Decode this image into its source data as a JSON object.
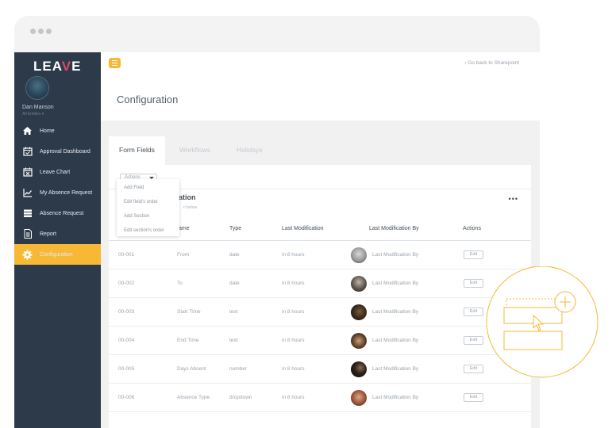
{
  "colors": {
    "accent": "#f7b835",
    "sidebar": "#2d3a4a",
    "highlight": "#e0476b"
  },
  "app": {
    "logo_prefix": "LEA",
    "logo_highlight": "V",
    "logo_suffix": "E"
  },
  "user": {
    "name": "Dan Manson",
    "role": "All Entities ▾"
  },
  "sidebar": {
    "items": [
      {
        "label": "Home",
        "icon": "home-icon"
      },
      {
        "label": "Approval Dashboard",
        "icon": "calendar-check-icon"
      },
      {
        "label": "Leave Chart",
        "icon": "calendar-x-icon"
      },
      {
        "label": "My Absence Request",
        "icon": "trend-chart-icon"
      },
      {
        "label": "Absence Request",
        "icon": "list-icon"
      },
      {
        "label": "Report",
        "icon": "document-icon"
      },
      {
        "label": "Configuration",
        "icon": "gear-icon",
        "active": true
      }
    ]
  },
  "header": {
    "back_link": "‹  Go back to Sharepoint"
  },
  "page": {
    "title": "Configuration"
  },
  "tabs": [
    {
      "label": "Form Fields",
      "active": true
    },
    {
      "label": "Workflows"
    },
    {
      "label": "Holidays"
    }
  ],
  "actions": {
    "label": "Actions",
    "menu": [
      "Add Field",
      "Edit field's order",
      "Add Section",
      "Edit section's order"
    ]
  },
  "section": {
    "title": "ation",
    "subtitle": "n below",
    "more": "•••"
  },
  "table": {
    "headers": [
      "ame",
      "Type",
      "Last Modification",
      "Last Modification By",
      "Actions"
    ],
    "rows": [
      {
        "id": "00-001",
        "name": "From",
        "type": "date",
        "modified": "in 8 hours",
        "by": "Last Modification By",
        "action": "Edit"
      },
      {
        "id": "00-002",
        "name": "To",
        "type": "date",
        "modified": "in 8 hours",
        "by": "Last Modification By",
        "action": "Edit"
      },
      {
        "id": "00-003",
        "name": "Start Time",
        "type": "text",
        "modified": "in 8 hours",
        "by": "Last Modification By",
        "action": "Edit"
      },
      {
        "id": "00-004",
        "name": "End Time",
        "type": "text",
        "modified": "in 8 hours",
        "by": "Last Modification By",
        "action": "Edit"
      },
      {
        "id": "00-005",
        "name": "Days Absent",
        "type": "number",
        "modified": "in 8 hours",
        "by": "Last Modification By",
        "action": "Edit"
      },
      {
        "id": "00-006",
        "name": "Absence Type",
        "type": "dropdown",
        "modified": "in 8 hours",
        "by": "Last Modification By",
        "action": "Edit"
      }
    ]
  }
}
